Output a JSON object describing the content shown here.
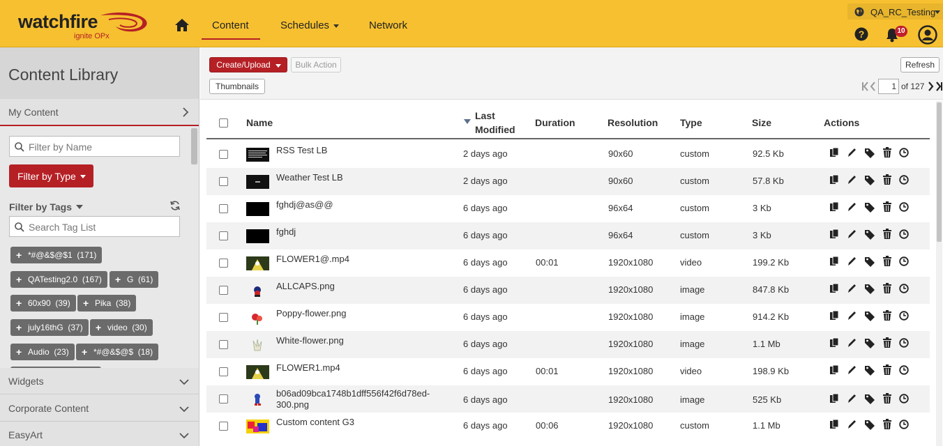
{
  "header": {
    "logo_text": "watchfire",
    "logo_sub": "ignite OPx",
    "nav": {
      "content": "Content",
      "schedules": "Schedules",
      "network": "Network"
    },
    "tenant": "QA_RC_Testing",
    "notifications": "10",
    "accent": "#f6c030",
    "brand_red": "#b52025"
  },
  "sidebar": {
    "title": "Content Library",
    "my_content": "My Content",
    "filter_name_placeholder": "Filter by Name",
    "filter_type": "Filter by Type",
    "filter_tags": "Filter by Tags",
    "search_tag_placeholder": "Search Tag List",
    "tags": [
      {
        "label": "*#@&$@$1",
        "count": "(171)"
      },
      {
        "label": "QATesting2.0",
        "count": "(167)"
      },
      {
        "label": "G",
        "count": "(61)"
      },
      {
        "label": "60x90",
        "count": "(39)"
      },
      {
        "label": "Pika",
        "count": "(38)"
      },
      {
        "label": "july16thG",
        "count": "(37)"
      },
      {
        "label": "video",
        "count": "(30)"
      },
      {
        "label": "Audio",
        "count": "(23)"
      },
      {
        "label": "*#@&$@$",
        "count": "(18)"
      }
    ],
    "sections": [
      "Widgets",
      "Corporate Content",
      "EasyArt"
    ]
  },
  "toolbar": {
    "create": "Create/Upload",
    "bulk": "Bulk Action",
    "thumbnails": "Thumbnails",
    "refresh": "Refresh",
    "page": "1",
    "of_pages": "of 127"
  },
  "table": {
    "headers": {
      "name": "Name",
      "last_modified_1": "Last",
      "last_modified_2": "Modified",
      "duration": "Duration",
      "resolution": "Resolution",
      "type": "Type",
      "size": "Size",
      "actions": "Actions"
    },
    "rows": [
      {
        "name": "RSS Test LB",
        "name2": "",
        "modified": "2 days ago",
        "duration": "",
        "resolution": "90x60",
        "type": "custom",
        "size": "92.5 Kb"
      },
      {
        "name": "Weather Test LB",
        "name2": "",
        "modified": "2 days ago",
        "duration": "",
        "resolution": "90x60",
        "type": "custom",
        "size": "57.8 Kb"
      },
      {
        "name": "fghdj@as@@",
        "name2": "",
        "modified": "6 days ago",
        "duration": "",
        "resolution": "96x64",
        "type": "custom",
        "size": "3 Kb"
      },
      {
        "name": "fghdj",
        "name2": "",
        "modified": "6 days ago",
        "duration": "",
        "resolution": "96x64",
        "type": "custom",
        "size": "3 Kb"
      },
      {
        "name": "FLOWER1@.mp4",
        "name2": "",
        "modified": "6 days ago",
        "duration": "00:01",
        "resolution": "1920x1080",
        "type": "video",
        "size": "199.2 Kb"
      },
      {
        "name": "ALLCAPS.png",
        "name2": "",
        "modified": "6 days ago",
        "duration": "",
        "resolution": "1920x1080",
        "type": "image",
        "size": "847.8 Kb"
      },
      {
        "name": "Poppy-flower.png",
        "name2": "",
        "modified": "6 days ago",
        "duration": "",
        "resolution": "1920x1080",
        "type": "image",
        "size": "914.2 Kb"
      },
      {
        "name": "White-flower.png",
        "name2": "",
        "modified": "6 days ago",
        "duration": "",
        "resolution": "1920x1080",
        "type": "image",
        "size": "1.1 Mb"
      },
      {
        "name": "FLOWER1.mp4",
        "name2": "",
        "modified": "6 days ago",
        "duration": "00:01",
        "resolution": "1920x1080",
        "type": "video",
        "size": "198.9 Kb"
      },
      {
        "name": "b06ad09bca1748b1dff556f42f6d78ed-",
        "name2": "300.png",
        "modified": "6 days ago",
        "duration": "",
        "resolution": "1920x1080",
        "type": "image",
        "size": "525 Kb"
      },
      {
        "name": "Custom content G3",
        "name2": "",
        "modified": "6 days ago",
        "duration": "00:06",
        "resolution": "1920x1080",
        "type": "custom",
        "size": "1.1 Mb"
      }
    ]
  }
}
